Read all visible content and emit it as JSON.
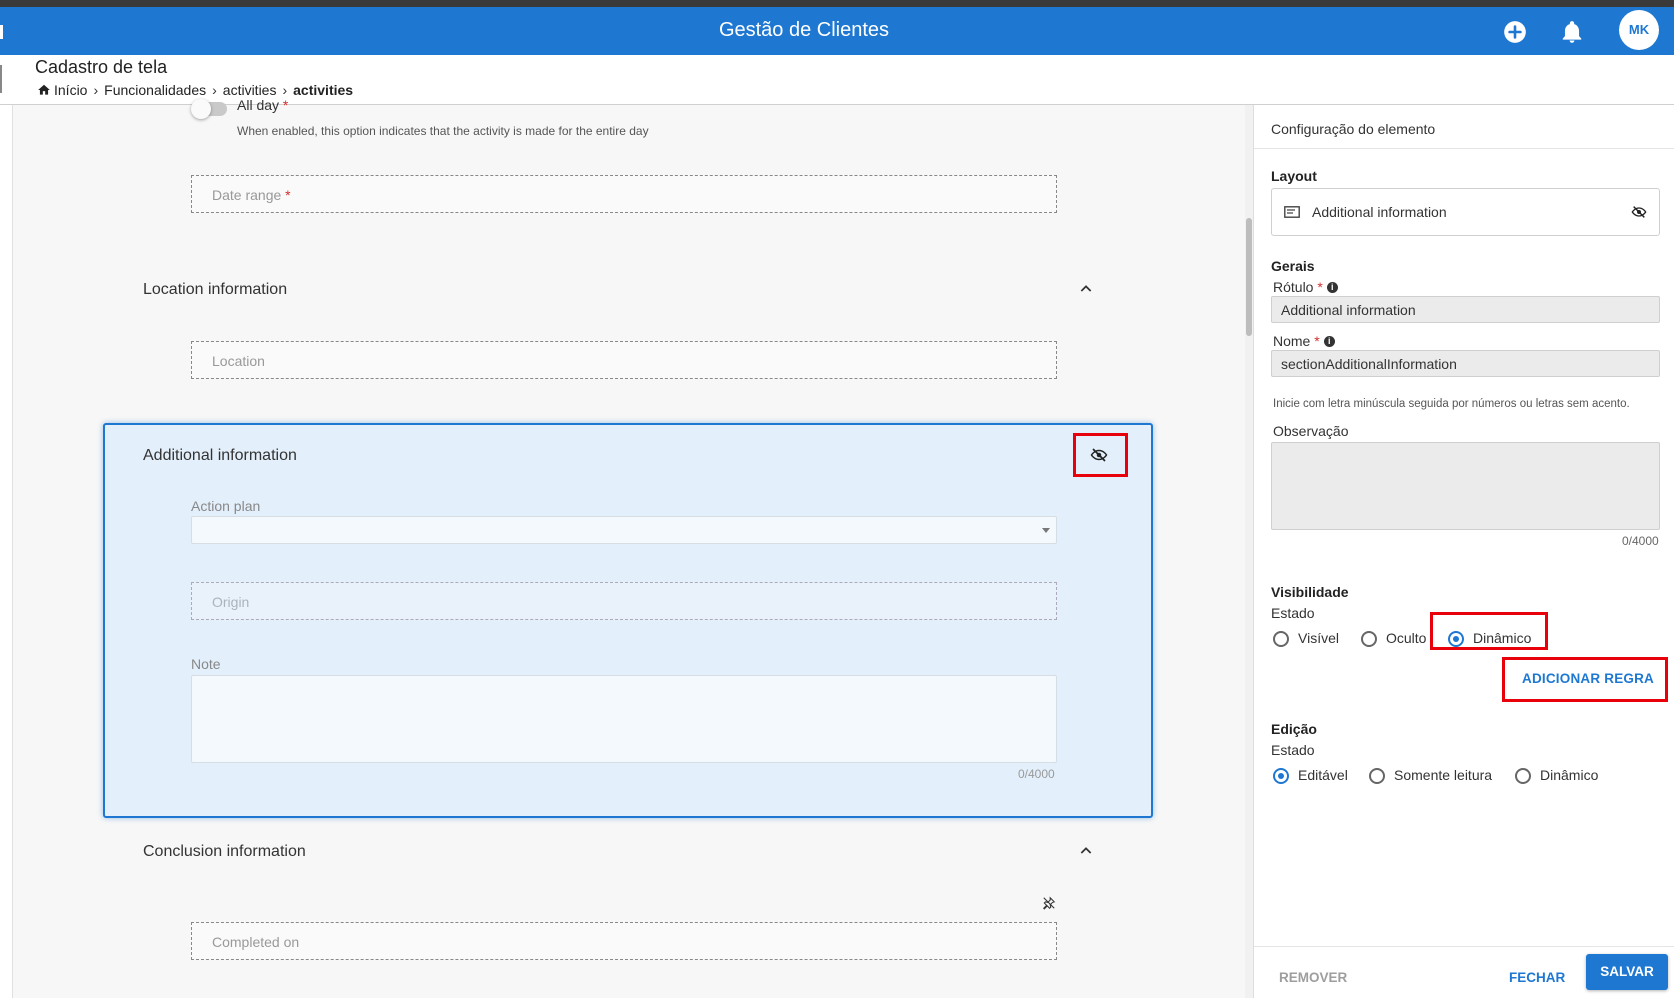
{
  "app": {
    "title": "Gestão de Clientes",
    "avatar_initials": "MK",
    "accent": "#1e78d2"
  },
  "header": {
    "page_title": "Cadastro de tela",
    "breadcrumb": [
      "Início",
      "Funcionalidades",
      "activities",
      "activities"
    ]
  },
  "form": {
    "all_day_label": "All day",
    "all_day_required": "*",
    "all_day_hint": "When enabled, this option indicates that the activity is made for the entire day",
    "date_range_placeholder": "Date range",
    "date_range_required": "*",
    "location_section": "Location information",
    "location_placeholder": "Location",
    "additional_section": "Additional information",
    "action_plan_label": "Action plan",
    "origin_placeholder": "Origin",
    "note_label": "Note",
    "note_counter": "0/4000",
    "conclusion_section": "Conclusion information",
    "completed_on_placeholder": "Completed on"
  },
  "panel": {
    "heading": "Configuração do elemento",
    "layout_label": "Layout",
    "layout_value": "Additional information",
    "gerais_label": "Gerais",
    "rotulo_label": "Rótulo",
    "rotulo_value": "Additional information",
    "nome_label": "Nome",
    "nome_value": "sectionAdditionalInformation",
    "nome_hint": "Inicie com letra minúscula seguida por números ou letras sem acento.",
    "observacao_label": "Observação",
    "observacao_counter": "0/4000",
    "required_mark": "*",
    "visibilidade_label": "Visibilidade",
    "visibilidade_estado": "Estado",
    "visibilidade_options": [
      "Visível",
      "Oculto",
      "Dinâmico"
    ],
    "visibilidade_selected": "Dinâmico",
    "add_rule_button": "ADICIONAR REGRA",
    "edicao_label": "Edição",
    "edicao_estado": "Estado",
    "edicao_options": [
      "Editável",
      "Somente leitura",
      "Dinâmico"
    ],
    "edicao_selected": "Editável",
    "remove_button": "REMOVER",
    "close_button": "FECHAR",
    "save_button": "SALVAR"
  }
}
